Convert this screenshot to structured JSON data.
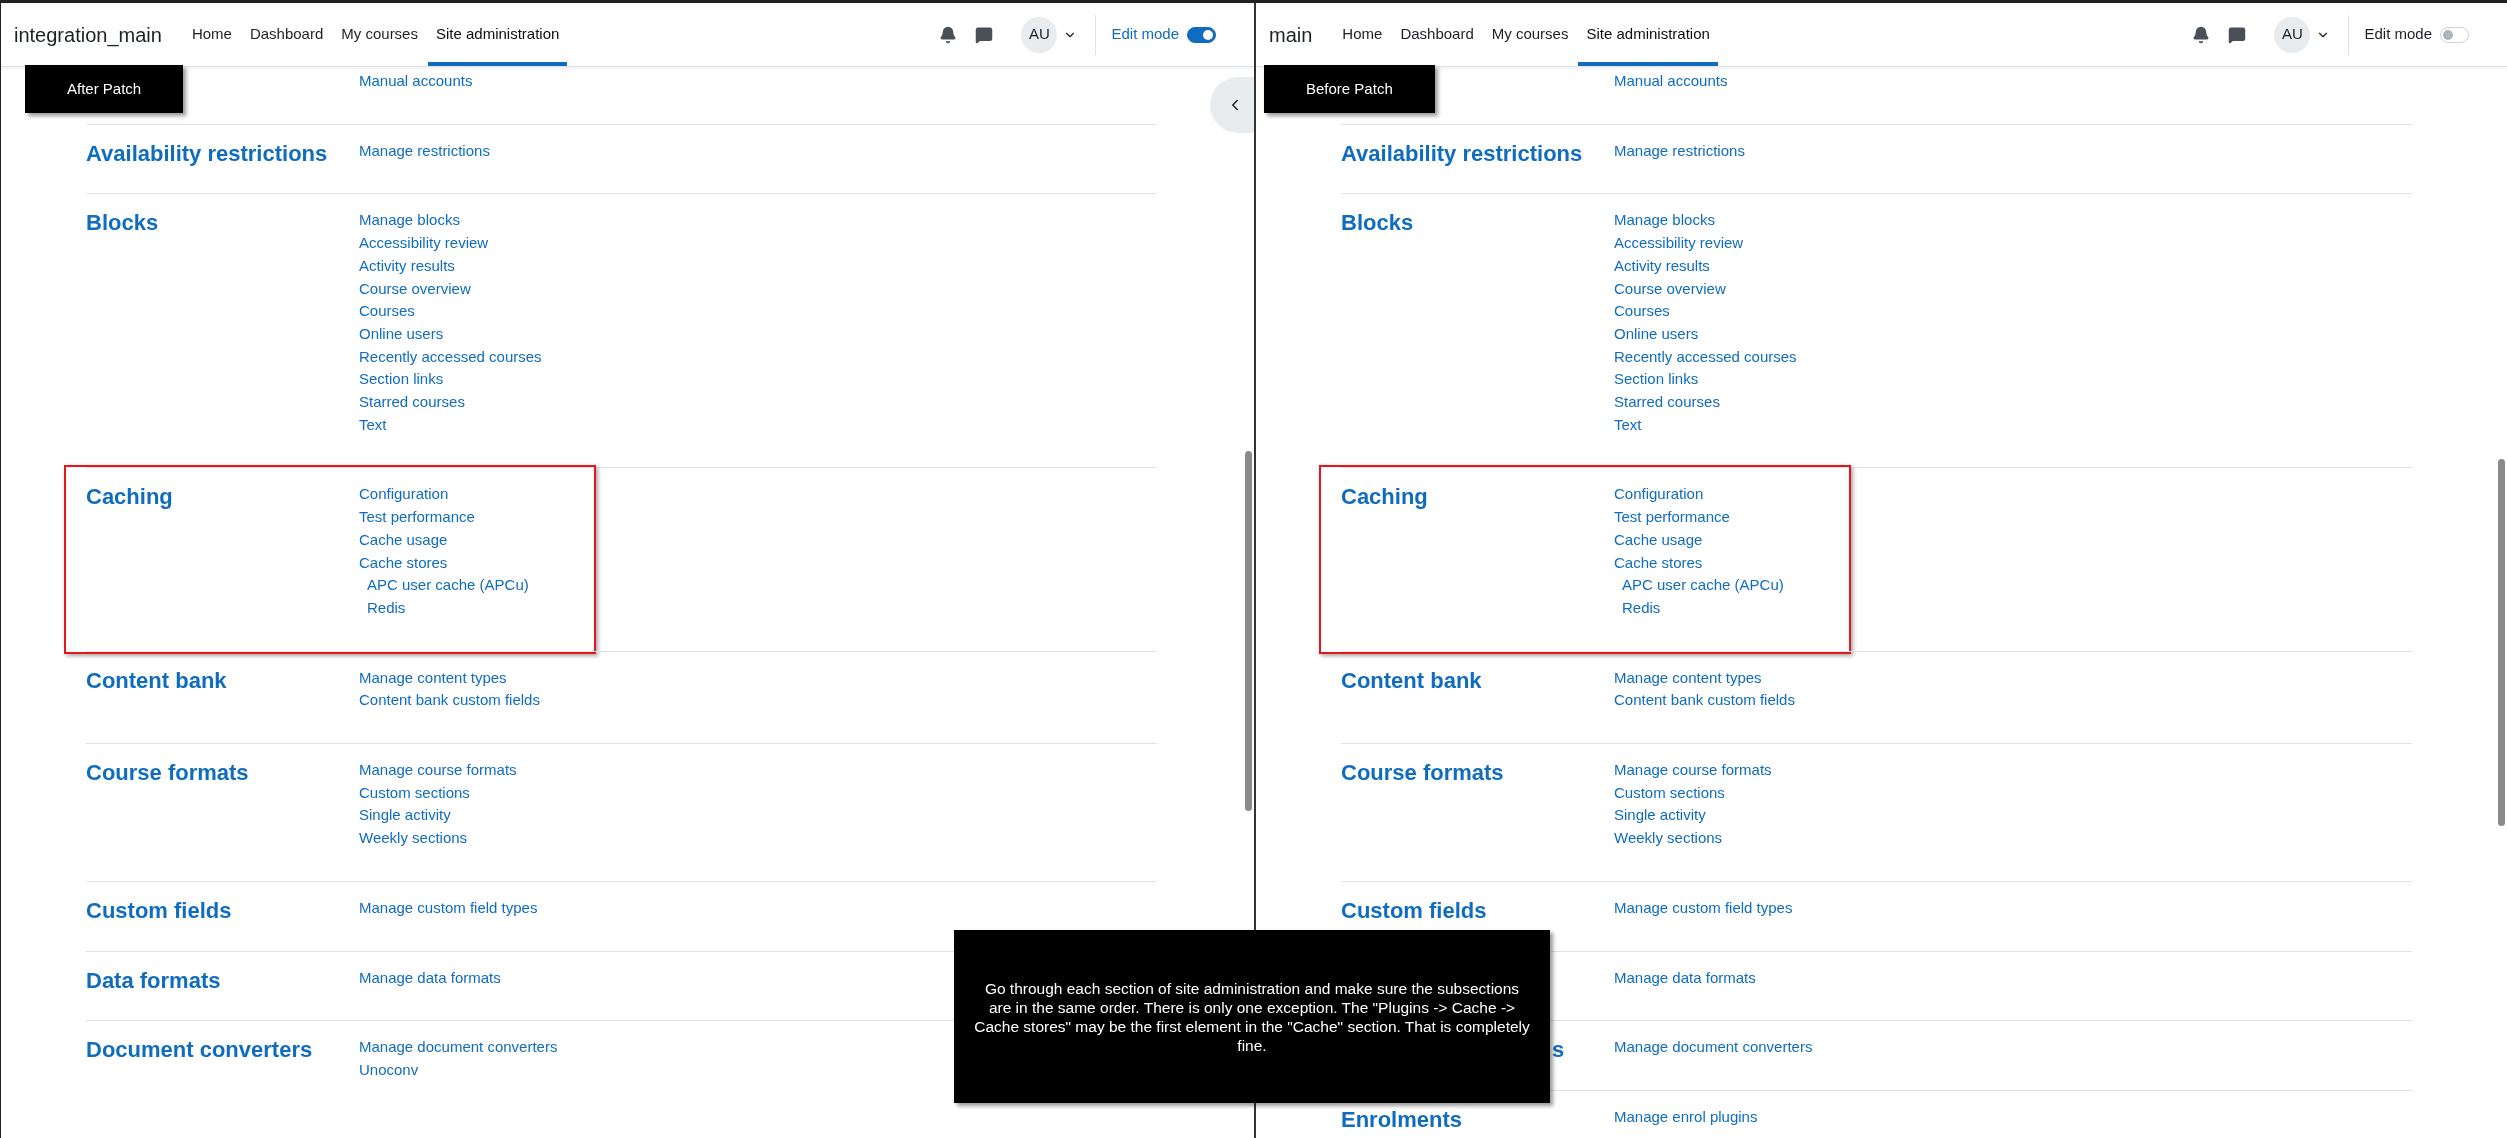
{
  "panes": [
    {
      "site_name": "integration_main",
      "nav": [
        {
          "label": "Home",
          "selected": false
        },
        {
          "label": "Dashboard",
          "selected": false
        },
        {
          "label": "My courses",
          "selected": false
        },
        {
          "label": "Site administration",
          "selected": true
        }
      ],
      "avatar": "AU",
      "edit_mode": {
        "label": "Edit mode",
        "on": true
      },
      "patch_label": "After Patch",
      "drawer_button": true,
      "sections": [
        {
          "links": [
            {
              "label": "Manual accounts"
            }
          ],
          "highlighted": false
        },
        {
          "heading": "Availability restrictions",
          "links": [
            {
              "label": "Manage restrictions"
            }
          ],
          "highlighted": false
        },
        {
          "heading": "Blocks",
          "links": [
            {
              "label": "Manage blocks"
            },
            {
              "label": "Accessibility review"
            },
            {
              "label": "Activity results"
            },
            {
              "label": "Course overview"
            },
            {
              "label": "Courses"
            },
            {
              "label": "Online users"
            },
            {
              "label": "Recently accessed courses"
            },
            {
              "label": "Section links"
            },
            {
              "label": "Starred courses"
            },
            {
              "label": "Text"
            }
          ],
          "highlighted": false
        },
        {
          "heading": "Caching",
          "links": [
            {
              "label": "Configuration"
            },
            {
              "label": "Test performance"
            },
            {
              "label": "Cache usage"
            },
            {
              "label": "Cache stores",
              "children": [
                {
                  "label": "APC user cache (APCu)"
                },
                {
                  "label": "Redis"
                }
              ]
            }
          ],
          "highlighted": true
        },
        {
          "heading": "Content bank",
          "links": [
            {
              "label": "Manage content types"
            },
            {
              "label": "Content bank custom fields"
            }
          ],
          "highlighted": false
        },
        {
          "heading": "Course formats",
          "links": [
            {
              "label": "Manage course formats"
            },
            {
              "label": "Custom sections"
            },
            {
              "label": "Single activity"
            },
            {
              "label": "Weekly sections"
            }
          ],
          "highlighted": false
        },
        {
          "heading": "Custom fields",
          "links": [
            {
              "label": "Manage custom field types"
            }
          ],
          "highlighted": false
        },
        {
          "heading": "Data formats",
          "links": [
            {
              "label": "Manage data formats"
            }
          ],
          "highlighted": false
        },
        {
          "heading": "Document converters",
          "links": [
            {
              "label": "Manage document converters"
            },
            {
              "label": "Unoconv"
            }
          ],
          "highlighted": false
        }
      ]
    },
    {
      "site_name": "main",
      "nav": [
        {
          "label": "Home",
          "selected": false
        },
        {
          "label": "Dashboard",
          "selected": false
        },
        {
          "label": "My courses",
          "selected": false
        },
        {
          "label": "Site administration",
          "selected": true
        }
      ],
      "avatar": "AU",
      "edit_mode": {
        "label": "Edit mode",
        "on": false
      },
      "patch_label": "Before Patch",
      "drawer_button": false,
      "sections": [
        {
          "links": [
            {
              "label": "Manual accounts"
            }
          ],
          "highlighted": false
        },
        {
          "heading": "Availability restrictions",
          "links": [
            {
              "label": "Manage restrictions"
            }
          ],
          "highlighted": false
        },
        {
          "heading": "Blocks",
          "links": [
            {
              "label": "Manage blocks"
            },
            {
              "label": "Accessibility review"
            },
            {
              "label": "Activity results"
            },
            {
              "label": "Course overview"
            },
            {
              "label": "Courses"
            },
            {
              "label": "Online users"
            },
            {
              "label": "Recently accessed courses"
            },
            {
              "label": "Section links"
            },
            {
              "label": "Starred courses"
            },
            {
              "label": "Text"
            }
          ],
          "highlighted": false
        },
        {
          "heading": "Caching",
          "links": [
            {
              "label": "Configuration"
            },
            {
              "label": "Test performance"
            },
            {
              "label": "Cache usage"
            },
            {
              "label": "Cache stores",
              "children": [
                {
                  "label": "APC user cache (APCu)"
                },
                {
                  "label": "Redis"
                }
              ]
            }
          ],
          "highlighted": true
        },
        {
          "heading": "Content bank",
          "links": [
            {
              "label": "Manage content types"
            },
            {
              "label": "Content bank custom fields"
            }
          ],
          "highlighted": false
        },
        {
          "heading": "Course formats",
          "links": [
            {
              "label": "Manage course formats"
            },
            {
              "label": "Custom sections"
            },
            {
              "label": "Single activity"
            },
            {
              "label": "Weekly sections"
            }
          ],
          "highlighted": false
        },
        {
          "heading": "Custom fields",
          "links": [
            {
              "label": "Manage custom field types"
            }
          ],
          "highlighted": false
        },
        {
          "links": [
            {
              "label": "Manage data formats"
            }
          ],
          "highlighted": false
        },
        {
          "heading": "s",
          "kind": "clipped",
          "links": [
            {
              "label": "Manage document converters"
            }
          ],
          "highlighted": false
        },
        {
          "heading": "Enrolments",
          "links": [
            {
              "label": "Manage enrol plugins"
            }
          ],
          "highlighted": false
        }
      ]
    }
  ],
  "note": "Go through each section of site administration and make sure the subsections are in the same order. There is only one exception. The \"Plugins -> Cache -> Cache stores\" may be the first element in the \"Cache\" section. That is completely fine."
}
